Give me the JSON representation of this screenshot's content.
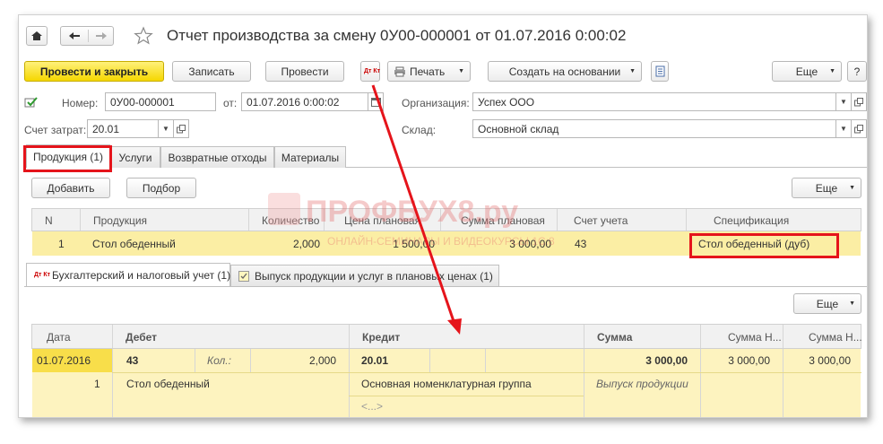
{
  "title": "Отчет производства за смену 0У00-000001 от 01.07.2016 0:00:02",
  "toolbar": {
    "post_close": "Провести и закрыть",
    "save": "Записать",
    "post": "Провести",
    "dt_kt": "Дт Кт",
    "print": "Печать",
    "create_based": "Создать на основании",
    "more": "Еще",
    "help": "?"
  },
  "form": {
    "number_label": "Номер:",
    "number_value": "0У00-000001",
    "date_label": "от:",
    "date_value": "01.07.2016  0:00:02",
    "org_label": "Организация:",
    "org_value": "Успех ООО",
    "cost_label": "Счет затрат:",
    "cost_value": "20.01",
    "warehouse_label": "Склад:",
    "warehouse_value": "Основной склад"
  },
  "tabs": [
    "Продукция (1)",
    "Услуги",
    "Возвратные отходы",
    "Материалы"
  ],
  "products": {
    "add": "Добавить",
    "select": "Подбор",
    "more": "Еще",
    "columns": [
      "N",
      "Продукция",
      "Количество",
      "Цена плановая",
      "Сумма плановая",
      "Счет учета",
      "Спецификация"
    ],
    "row": {
      "n": "1",
      "product": "Стол обеденный",
      "qty": "2,000",
      "price": "1 500,00",
      "sum": "3 000,00",
      "account": "43",
      "spec": "Стол обеденный (дуб)"
    }
  },
  "watermark": {
    "line1": "ПРОФБУХ8.ру",
    "line2": "ОНЛАЙН-СЕМИНАРЫ И ВИДЕОКУРСЫ 1С:8"
  },
  "subtabs": [
    "Бухгалтерский и налоговый учет (1)",
    "Выпуск продукции и услуг в плановых ценах (1)"
  ],
  "postings": {
    "more": "Еще",
    "columns": [
      "Дата",
      "Дебет",
      "Кредит",
      "Сумма",
      "Сумма Н...",
      "Сумма Н..."
    ],
    "row1": {
      "date": "01.07.2016",
      "debit": "43",
      "qty_label": "Кол.:",
      "qty": "2,000",
      "credit": "20.01",
      "sum": "3 000,00",
      "sum_n1": "3 000,00",
      "sum_n2": "3 000,00"
    },
    "row2": {
      "n": "1",
      "debit_sub": "Стол обеденный",
      "credit_sub": "Основная номенклатурная группа",
      "sum_sub": "Выпуск продукции"
    },
    "row3": {
      "credit_sub2": "<...>"
    }
  }
}
